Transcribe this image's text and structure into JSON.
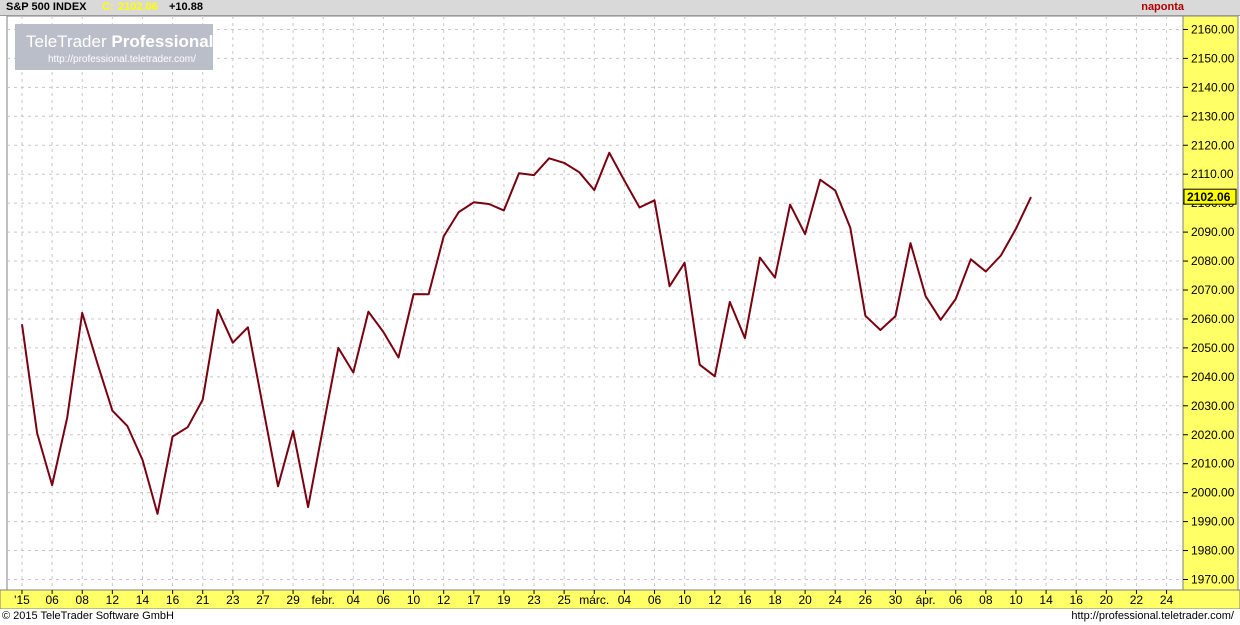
{
  "header": {
    "instrument": "S&P 500 INDEX",
    "close_label": "C",
    "close_value": "2102.06",
    "change": "+10.88",
    "period": "naponta"
  },
  "watermark": {
    "brand": "TeleTrader",
    "product": "Professional",
    "url": "http://professional.teletrader.com/"
  },
  "footer": {
    "copyright": "© 2015 TeleTrader Software GmbH",
    "url": "http://professional.teletrader.com/"
  },
  "colors": {
    "line": "#7a0010",
    "axis_bg": "#ffff66",
    "last_price_bg": "#ffff00",
    "header_bg": "#d9d9d9",
    "grid": "#c8c8c8",
    "watermark_bg": "#b9bec8"
  },
  "chart_data": {
    "type": "line",
    "title": "S&P 500 INDEX",
    "ylim": [
      1965,
      2165
    ],
    "y_ticks": [
      "1970.00",
      "1980.00",
      "1990.00",
      "2000.00",
      "2010.00",
      "2020.00",
      "2030.00",
      "2040.00",
      "2050.00",
      "2060.00",
      "2070.00",
      "2080.00",
      "2090.00",
      "2100.00",
      "2110.00",
      "2120.00",
      "2130.00",
      "2140.00",
      "2150.00",
      "2160.00"
    ],
    "x_ticks": [
      "'15",
      "06",
      "08",
      "12",
      "14",
      "16",
      "21",
      "23",
      "27",
      "29",
      "febr.",
      "04",
      "06",
      "10",
      "12",
      "17",
      "19",
      "23",
      "25",
      "márc.",
      "04",
      "06",
      "10",
      "12",
      "16",
      "18",
      "20",
      "24",
      "26",
      "30",
      "ápr.",
      "06",
      "08",
      "10",
      "14",
      "16",
      "20",
      "22",
      "24"
    ],
    "x_tick_note": "tick labels are evenly spaced at two trading sessions each; data ends at the 10 (April) label",
    "last_value": "2102.06",
    "grid": true,
    "series": [
      {
        "values": [
          2058.2,
          2020.6,
          2002.6,
          2025.9,
          2062.1,
          2044.8,
          2028.3,
          2023.0,
          2011.3,
          1992.7,
          2019.4,
          2022.6,
          2032.1,
          2063.2,
          2051.8,
          2057.1,
          2029.5,
          2002.2,
          2021.3,
          1995.0,
          2022.7,
          2050.0,
          2041.5,
          2062.5,
          2055.5,
          2046.7,
          2068.6,
          2068.5,
          2088.5,
          2096.9,
          2100.3,
          2099.7,
          2097.5,
          2110.3,
          2109.7,
          2115.5,
          2113.9,
          2110.7,
          2104.5,
          2117.4,
          2107.8,
          2098.5,
          2101.0,
          2071.3,
          2079.4,
          2044.2,
          2040.2,
          2065.9,
          2053.4,
          2081.2,
          2074.3,
          2099.5,
          2089.3,
          2108.1,
          2104.4,
          2091.5,
          2061.1,
          2056.2,
          2061.0,
          2086.2,
          2067.9,
          2059.7,
          2066.9,
          2080.6,
          2076.4,
          2081.9,
          2091.2,
          2102.1
        ]
      }
    ]
  }
}
